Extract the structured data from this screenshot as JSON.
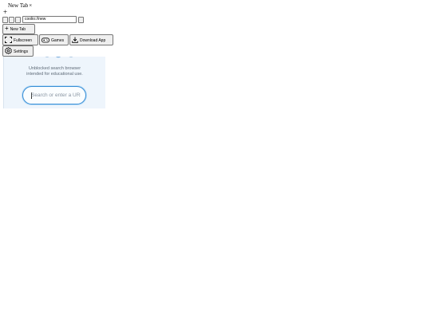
{
  "tabs": [
    {
      "label": "New Tab",
      "close": "×"
    }
  ],
  "newtab_plus": "+",
  "address": {
    "value": "coolio://new"
  },
  "buttons": {
    "newtab": {
      "icon": "plus-icon",
      "glyph": "+",
      "label": "New Tab"
    },
    "fullscreen": {
      "icon": "fullscreen-icon",
      "label": "Fullscreen"
    },
    "games": {
      "icon": "gamepad-icon",
      "label": "Games"
    },
    "download": {
      "icon": "download-icon",
      "label": "Download App"
    },
    "settings": {
      "icon": "gear-icon",
      "label": "Settings"
    }
  },
  "content": {
    "tagline_line1": "Unblocked search browser",
    "tagline_line2": "intended for educational use.",
    "search_placeholder": "Search or enter a URL"
  },
  "colors": {
    "frame_bg": "#eef5fc",
    "search_border": "#3a8fd6",
    "tagline": "#5f6b78"
  }
}
